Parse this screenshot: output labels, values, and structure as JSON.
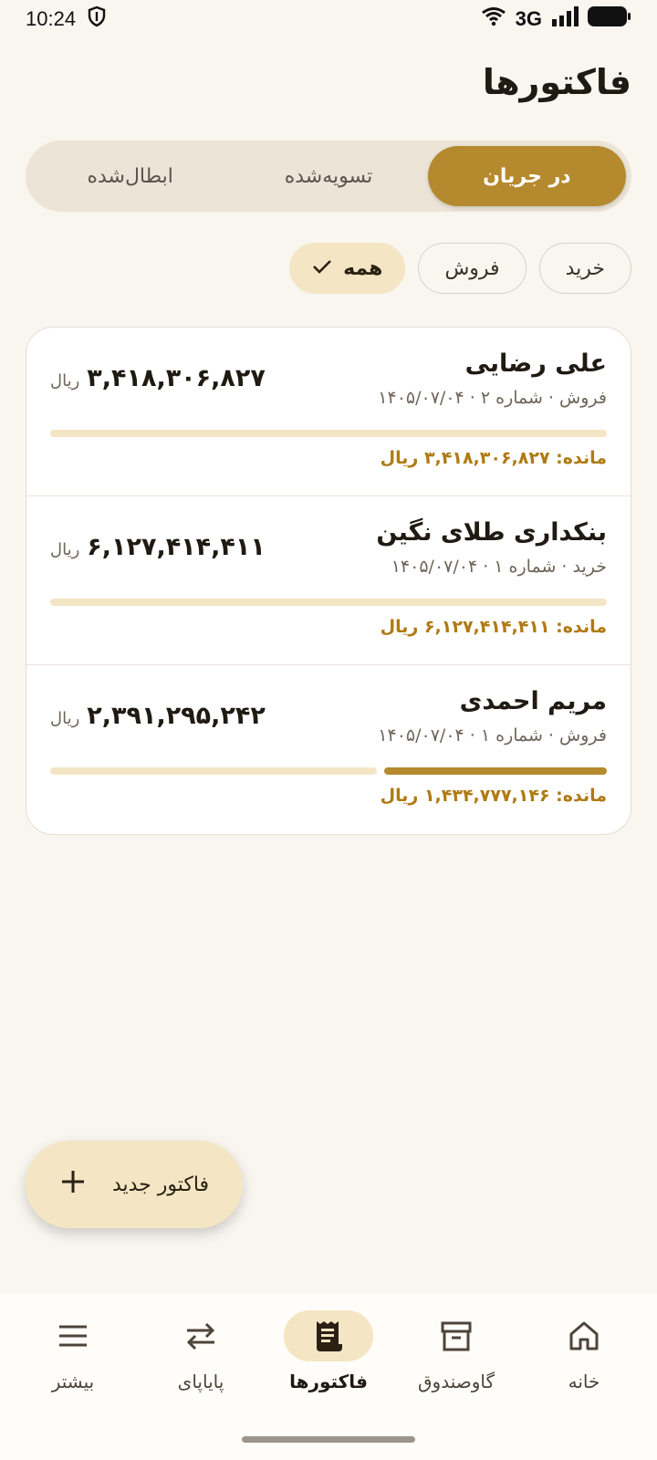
{
  "status_bar": {
    "time": "10:24",
    "network": "3G"
  },
  "page": {
    "title": "فاکتورها"
  },
  "tabs": [
    {
      "label": "در جریان",
      "active": true
    },
    {
      "label": "تسویه‌شده",
      "active": false
    },
    {
      "label": "ابطال‌شده",
      "active": false
    }
  ],
  "filters": [
    {
      "label": "همه",
      "selected": true
    },
    {
      "label": "فروش",
      "selected": false
    },
    {
      "label": "خرید",
      "selected": false
    }
  ],
  "invoices": [
    {
      "name": "علی رضایی",
      "meta": "فروش · شماره ۲ · ۱۴۰۵/۰۷/۰۴",
      "amount": "۳,۴۱۸,۳۰۶,۸۲۷",
      "currency": "ریال",
      "remaining": "مانده: ۳,۴۱۸,۳۰۶,۸۲۷ ریال",
      "paid_fraction": 0
    },
    {
      "name": "بنکداری طلای نگین",
      "meta": "خرید · شماره ۱ · ۱۴۰۵/۰۷/۰۴",
      "amount": "۶,۱۲۷,۴۱۴,۴۱۱",
      "currency": "ریال",
      "remaining": "مانده: ۶,۱۲۷,۴۱۴,۴۱۱ ریال",
      "paid_fraction": 0
    },
    {
      "name": "مریم احمدی",
      "meta": "فروش · شماره ۱ · ۱۴۰۵/۰۷/۰۴",
      "amount": "۲,۳۹۱,۲۹۵,۲۴۲",
      "currency": "ریال",
      "remaining": "مانده: ۱,۴۳۴,۷۷۷,۱۴۶ ریال",
      "paid_fraction": 0.4
    }
  ],
  "fab": {
    "label": "فاکتور جدید"
  },
  "nav": [
    {
      "label": "خانه",
      "icon": "home-icon",
      "active": false
    },
    {
      "label": "گاوصندوق",
      "icon": "archive-box-icon",
      "active": false
    },
    {
      "label": "فاکتورها",
      "icon": "receipt-icon",
      "active": true
    },
    {
      "label": "پایاپای",
      "icon": "swap-icon",
      "active": false
    },
    {
      "label": "بیشتر",
      "icon": "menu-icon",
      "active": false
    }
  ],
  "colors": {
    "accent": "#b58a2e",
    "accent_light": "#f4e6c4",
    "remaining_text": "#b07a14",
    "background": "#f9f6f0"
  }
}
